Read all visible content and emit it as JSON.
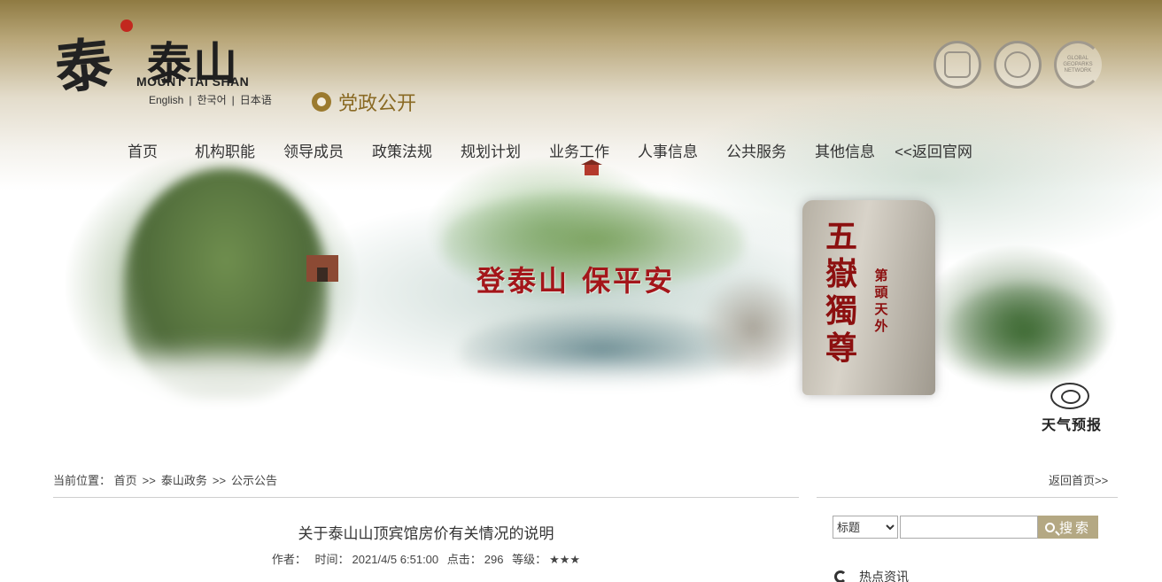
{
  "header": {
    "logo_calligraphy": "泰",
    "logo_cn": "泰山",
    "logo_en": "MOUNT TAI SHAN",
    "languages": [
      "English",
      "한국어",
      "日本语"
    ],
    "party_link": "党政公开",
    "partner_logos": [
      "world-heritage-emblem-icon",
      "unesco-heritage-icon",
      "global-geoparks-icon"
    ],
    "partner_logo_text": "GLOBAL GEOPARKS NETWORK"
  },
  "nav": {
    "items": [
      "首页",
      "机构职能",
      "领导成员",
      "政策法规",
      "规划计划",
      "业务工作",
      "人事信息",
      "公共服务",
      "其他信息",
      "<<返回官网"
    ]
  },
  "banner": {
    "slogan": "登泰山 保平安",
    "stele_main": "五嶽獨尊",
    "stele_side": "第頭天外",
    "weather": "天气预报"
  },
  "breadcrumb": {
    "label": "当前位置：",
    "items": [
      "首页",
      "泰山政务",
      "公示公告"
    ],
    "separator": ">>",
    "back_home": "返回首页>>"
  },
  "article": {
    "title": "关于泰山山顶宾馆房价有关情况的说明",
    "author_label": "作者：",
    "time_label": "时间：",
    "time": "2021/4/5 6:51:00",
    "clicks_label": "点击：",
    "clicks": "296",
    "level_label": "等级：",
    "level": "★★★"
  },
  "sidebar": {
    "search_select": "标题",
    "search_options": [
      "标题"
    ],
    "search_input_value": "",
    "search_button": "搜索",
    "hot_news": "热点资讯"
  },
  "colors": {
    "banner_top": "#8f7a42",
    "accent_gold": "#b4a883",
    "slogan_red": "#a4161a",
    "party_gold": "#8a6a24"
  }
}
